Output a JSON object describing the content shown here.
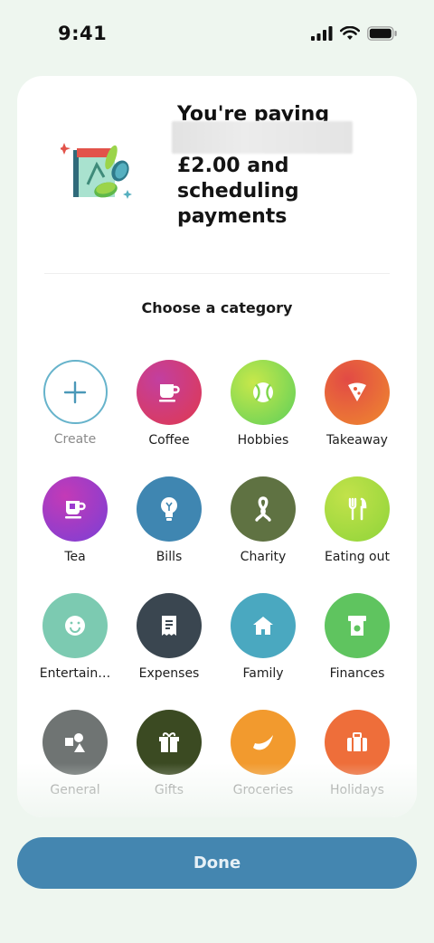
{
  "status_bar": {
    "time": "9:41"
  },
  "summary": {
    "line1": "You're paying",
    "rest": "£2.00 and scheduling payments"
  },
  "section_title": "Choose a category",
  "categories": [
    {
      "label": "Create",
      "icon": "plus-icon",
      "color": "#ffffff"
    },
    {
      "label": "Coffee",
      "icon": "coffee-cup-icon",
      "color": "#d63a63"
    },
    {
      "label": "Hobbies",
      "icon": "tennis-ball-icon",
      "color": "#7ed84a"
    },
    {
      "label": "Takeaway",
      "icon": "pizza-slice-icon",
      "color": "#e86a3a"
    },
    {
      "label": "Tea",
      "icon": "tea-cup-icon",
      "color": "#9a3bd0"
    },
    {
      "label": "Bills",
      "icon": "lightbulb-icon",
      "color": "#3f86b1"
    },
    {
      "label": "Charity",
      "icon": "ribbon-icon",
      "color": "#5f7242"
    },
    {
      "label": "Eating out",
      "icon": "cutlery-icon",
      "color": "#9fd93c"
    },
    {
      "label": "Entertain…",
      "icon": "smiley-icon",
      "color": "#7ccab1"
    },
    {
      "label": "Expenses",
      "icon": "receipt-icon",
      "color": "#3a4650"
    },
    {
      "label": "Family",
      "icon": "house-icon",
      "color": "#4aa8c0"
    },
    {
      "label": "Finances",
      "icon": "cash-icon",
      "color": "#5fc45f"
    },
    {
      "label": "General",
      "icon": "shapes-icon",
      "color": "#6f7473"
    },
    {
      "label": "Gifts",
      "icon": "gift-icon",
      "color": "#3b4a22"
    },
    {
      "label": "Groceries",
      "icon": "banana-icon",
      "color": "#f29a2e"
    },
    {
      "label": "Holidays",
      "icon": "suitcase-icon",
      "color": "#ee6e3a"
    }
  ],
  "done_label": "Done"
}
